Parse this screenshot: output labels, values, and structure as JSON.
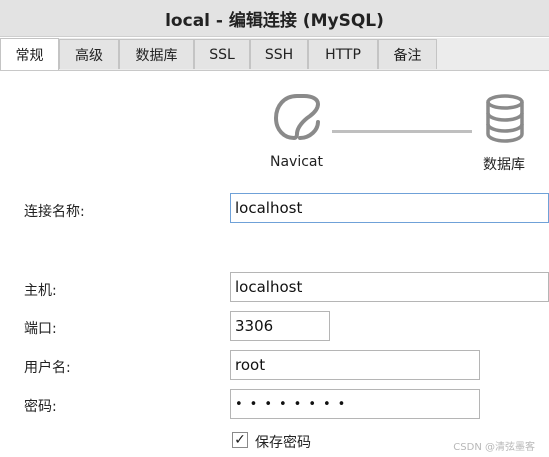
{
  "window": {
    "title": "local - 编辑连接 (MySQL)"
  },
  "tabs": [
    {
      "label": "常规",
      "active": true
    },
    {
      "label": "高级"
    },
    {
      "label": "数据库"
    },
    {
      "label": "SSL"
    },
    {
      "label": "SSH"
    },
    {
      "label": "HTTP"
    },
    {
      "label": "备注"
    }
  ],
  "diagram": {
    "left_label": "Navicat",
    "left_icon": "navicat-logo-icon",
    "right_label": "数据库",
    "right_icon": "database-icon"
  },
  "form": {
    "connection_name": {
      "label": "连接名称:",
      "value": "localhost"
    },
    "host": {
      "label": "主机:",
      "value": "localhost"
    },
    "port": {
      "label": "端口:",
      "value": "3306"
    },
    "username": {
      "label": "用户名:",
      "value": "root"
    },
    "password": {
      "label": "密码:",
      "value": "••••••••"
    },
    "save_password": {
      "label": "保存密码",
      "checked": true,
      "mark": "✓"
    }
  },
  "watermark": "CSDN @清弦墨客",
  "colors": {
    "focus_border": "#6fa1d8",
    "titlebar_bg": "#e3e3e3"
  }
}
